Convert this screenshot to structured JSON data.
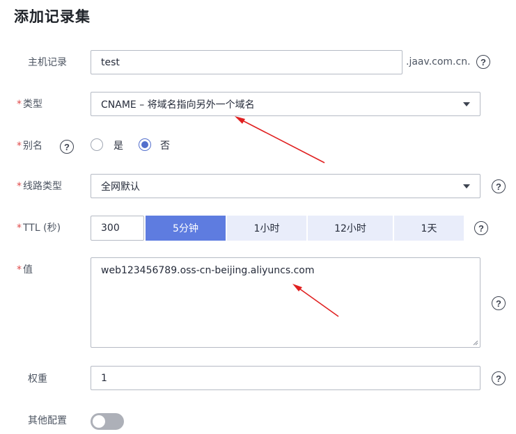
{
  "page_title": "添加记录集",
  "fields": {
    "host": {
      "label": "主机记录",
      "value": "test",
      "suffix": ".jaav.com.cn."
    },
    "type": {
      "label": "类型",
      "value": "CNAME – 将域名指向另外一个域名"
    },
    "alias": {
      "label": "别名",
      "options": [
        "是",
        "否"
      ],
      "selected": "否"
    },
    "line": {
      "label": "线路类型",
      "value": "全网默认"
    },
    "ttl": {
      "label": "TTL (秒)",
      "value": "300",
      "options": [
        "5分钟",
        "1小时",
        "12小时",
        "1天"
      ],
      "selected": "5分钟"
    },
    "value": {
      "label": "值",
      "value": "web123456789.oss-cn-beijing.aliyuncs.com"
    },
    "weight": {
      "label": "权重",
      "value": "1"
    },
    "other": {
      "label": "其他配置",
      "enabled": false
    }
  },
  "required_mark": "*",
  "help_glyph": "?",
  "colors": {
    "accent": "#5e7ce0",
    "required": "#e04a4a",
    "annotation_arrow": "#e02020"
  }
}
